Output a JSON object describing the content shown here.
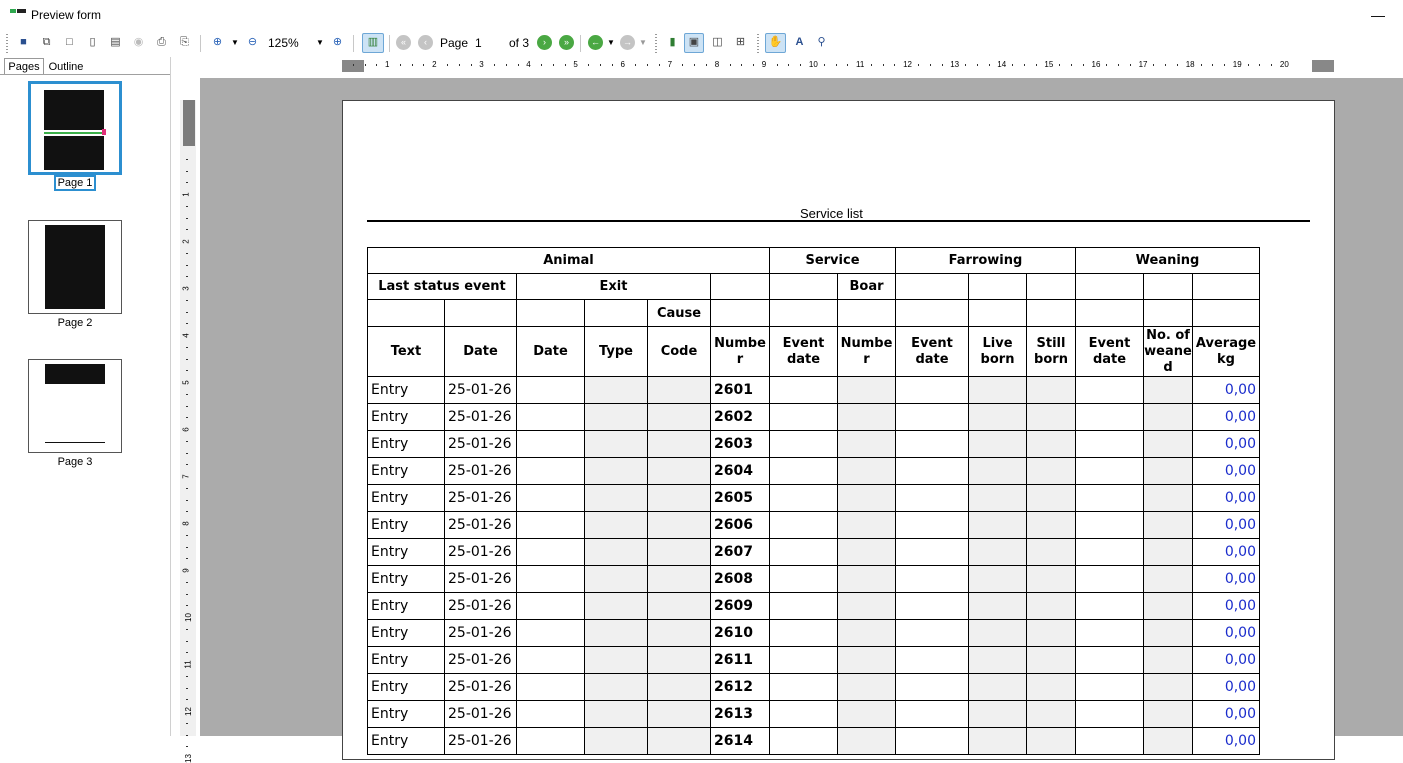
{
  "window": {
    "title": "Preview form",
    "minimize_glyph": "—"
  },
  "toolbar": {
    "zoom_value": "125%",
    "page_label": "Page",
    "page_value": "1",
    "page_of": "of 3",
    "icons": [
      "save-icon",
      "save-all-icon",
      "copy-icon",
      "page-icon",
      "export-icon",
      "stop-icon",
      "print-icon",
      "print-setup-icon",
      "zoom-in-icon",
      "zoom-out-icon",
      "zoom-add-icon",
      "thumbnail-toggle-icon",
      "first-page-icon",
      "prev-page-icon",
      "next-page-icon",
      "last-page-icon",
      "back-icon",
      "forward-icon",
      "single-page-icon",
      "page-width-icon",
      "two-pages-icon",
      "multi-page-icon",
      "hand-tool-icon",
      "text-select-icon",
      "find-icon"
    ]
  },
  "left_panel": {
    "tabs": [
      "Pages",
      "Outline"
    ],
    "thumbnails": [
      {
        "label": "Page 1",
        "selected": true
      },
      {
        "label": "Page 2",
        "selected": false
      },
      {
        "label": "Page 3",
        "selected": false
      }
    ]
  },
  "ruler": {
    "h_numbers": [
      "1",
      "2",
      "3",
      "4",
      "5",
      "6",
      "7",
      "8",
      "9",
      "10",
      "11",
      "12",
      "13",
      "14",
      "15",
      "16",
      "17",
      "18",
      "19",
      "20"
    ],
    "v_numbers": [
      "1",
      "2",
      "3",
      "4",
      "5",
      "6",
      "7",
      "8",
      "9",
      "10",
      "11",
      "12",
      "13"
    ]
  },
  "report": {
    "title": "Service list",
    "header_groups": [
      "Animal",
      "Service",
      "Farrowing",
      "Weaning"
    ],
    "header_row2": {
      "last_status_event": "Last status event",
      "exit": "Exit",
      "boar": "Boar"
    },
    "header_row3": {
      "cause": "Cause"
    },
    "columns": [
      "Text",
      "Date",
      "Date",
      "Type",
      "Code",
      "Number",
      "Event date",
      "Number",
      "Event date",
      "Live born",
      "Still born",
      "Event date",
      "No. of weaned",
      "Average kg"
    ],
    "rows": [
      {
        "text": "Entry",
        "date": "25-01-26",
        "number": "2601",
        "avg": "0,00"
      },
      {
        "text": "Entry",
        "date": "25-01-26",
        "number": "2602",
        "avg": "0,00"
      },
      {
        "text": "Entry",
        "date": "25-01-26",
        "number": "2603",
        "avg": "0,00"
      },
      {
        "text": "Entry",
        "date": "25-01-26",
        "number": "2604",
        "avg": "0,00"
      },
      {
        "text": "Entry",
        "date": "25-01-26",
        "number": "2605",
        "avg": "0,00"
      },
      {
        "text": "Entry",
        "date": "25-01-26",
        "number": "2606",
        "avg": "0,00"
      },
      {
        "text": "Entry",
        "date": "25-01-26",
        "number": "2607",
        "avg": "0,00"
      },
      {
        "text": "Entry",
        "date": "25-01-26",
        "number": "2608",
        "avg": "0,00"
      },
      {
        "text": "Entry",
        "date": "25-01-26",
        "number": "2609",
        "avg": "0,00"
      },
      {
        "text": "Entry",
        "date": "25-01-26",
        "number": "2610",
        "avg": "0,00"
      },
      {
        "text": "Entry",
        "date": "25-01-26",
        "number": "2611",
        "avg": "0,00"
      },
      {
        "text": "Entry",
        "date": "25-01-26",
        "number": "2612",
        "avg": "0,00"
      },
      {
        "text": "Entry",
        "date": "25-01-26",
        "number": "2613",
        "avg": "0,00"
      },
      {
        "text": "Entry",
        "date": "25-01-26",
        "number": "2614",
        "avg": "0,00"
      }
    ]
  },
  "colors": {
    "accent": "#2c8fd0",
    "avg_value": "#1a2ccc",
    "page_bg": "#ababab"
  }
}
